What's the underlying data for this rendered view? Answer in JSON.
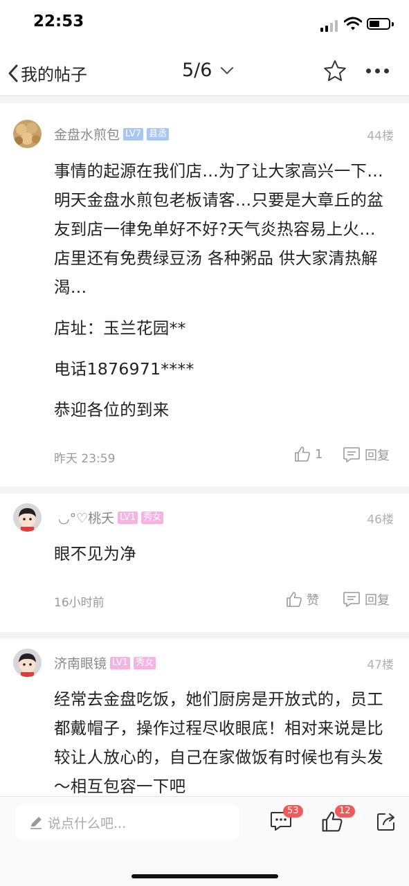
{
  "status_bar": {
    "time": "22:53"
  },
  "nav": {
    "back_label": "我的帖子",
    "page_indicator": "5/6"
  },
  "posts": [
    {
      "username": "金盘水煎包",
      "badges": [
        "LV7",
        "县丞"
      ],
      "floor": "44楼",
      "paragraphs": [
        "事情的起源在我们店…为了让大家高兴一下…明天金盘水煎包老板请客…只要是大章丘的盆友到店一律免单好不好?天气炎热容易上火…店里还有免费绿豆汤 各种粥品 供大家清热解渴…",
        "店址：玉兰花园**",
        "电话1876971****",
        "恭迎各位的到来"
      ],
      "time": "昨天 23:59",
      "like_label": "1",
      "reply_label": "回复"
    },
    {
      "username": "◡°♡桃夭",
      "badges": [
        "LV1",
        "秀女"
      ],
      "floor": "46楼",
      "paragraphs": [
        "眼不见为净"
      ],
      "time": "16小时前",
      "like_label": "赞",
      "reply_label": "回复"
    },
    {
      "username": "济南眼镜",
      "badges": [
        "LV1",
        "秀女"
      ],
      "floor": "47楼",
      "paragraphs": [
        "经常去金盘吃饭，她们厨房是开放式的，员工都戴帽子，操作过程尽收眼底！相对来说是比较让人放心的，自己在家做饭有时候也有头发～相互包容一下吧"
      ]
    }
  ],
  "bottom_bar": {
    "input_placeholder": "说点什么吧...",
    "comment_count": "53",
    "like_count": "12"
  },
  "icons": {
    "back": "chevron-left-icon",
    "dropdown": "chevron-down-icon",
    "favorite": "star-icon",
    "more": "more-dots-icon",
    "like": "thumb-up-icon",
    "reply": "comment-bubble-icon",
    "edit": "pencil-icon",
    "share": "share-icon"
  },
  "colors": {
    "badge_blue": "#a9c6f2",
    "badge_pink": "#f5b3e2",
    "count_red": "#f05a5a"
  }
}
